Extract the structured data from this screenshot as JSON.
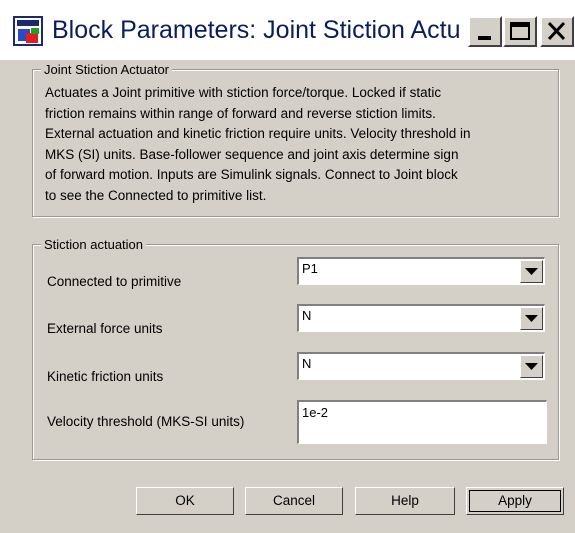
{
  "window": {
    "title": "Block Parameters: Joint Stiction Actua..."
  },
  "description_group": {
    "legend": "Joint Stiction Actuator",
    "lines": [
      "Actuates a Joint primitive with stiction force/torque. Locked if static",
      "friction remains within range of forward and reverse stiction limits.",
      "External actuation and kinetic friction require units. Velocity threshold in",
      "MKS (SI) units. Base-follower sequence and joint axis determine sign",
      "of forward motion. Inputs are Simulink signals. Connect to Joint block",
      "to see the Connected to primitive list."
    ]
  },
  "stiction_group": {
    "legend": "Stiction actuation",
    "connected_label": "Connected to primitive",
    "connected_value": "P1",
    "force_units_label": "External force units",
    "force_units_value": "N",
    "kinetic_label": "Kinetic friction units",
    "kinetic_value": "N",
    "velocity_label": "Velocity threshold (MKS-SI units)",
    "velocity_value": "1e-2"
  },
  "buttons": {
    "ok": "OK",
    "cancel": "Cancel",
    "help": "Help",
    "apply": "Apply"
  },
  "colors": {
    "dialog_bg": "#d4d0c8",
    "title_text": "#0a1e5c"
  },
  "icons": {
    "app": "simulink-block-icon",
    "minimize": "minimize-icon",
    "maximize": "maximize-icon",
    "close": "close-icon",
    "dropdown": "chevron-down-icon"
  }
}
